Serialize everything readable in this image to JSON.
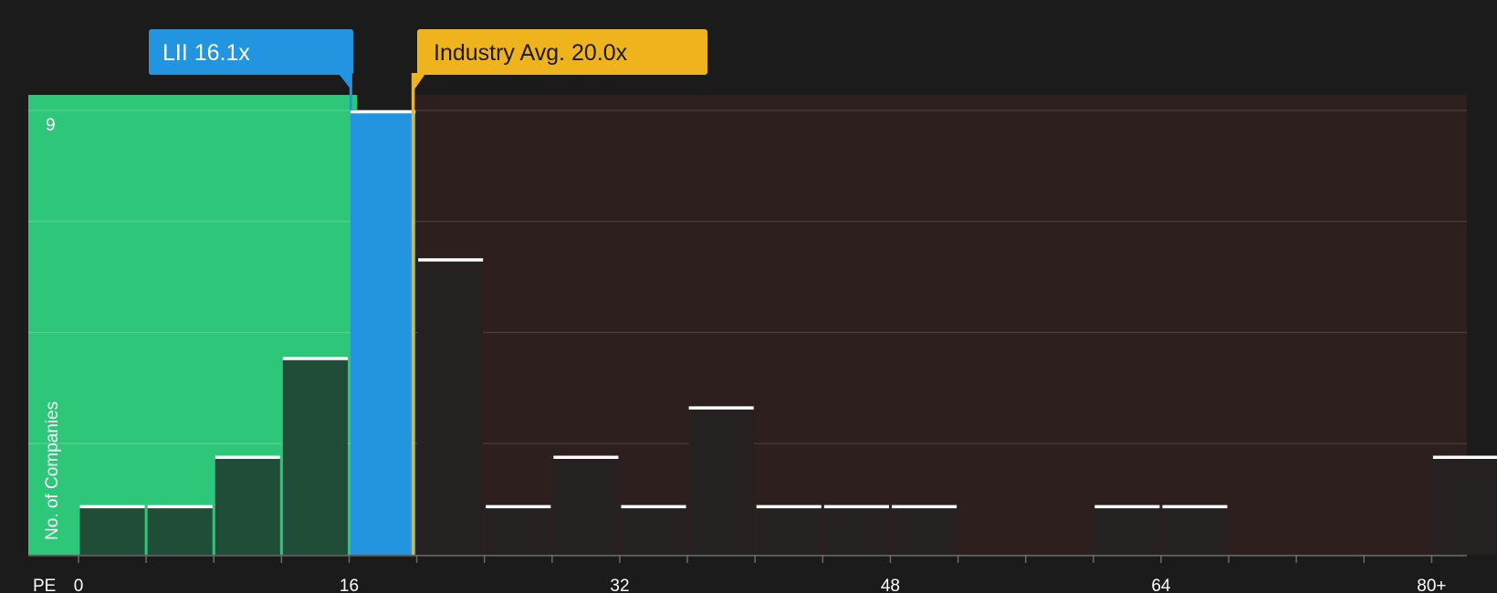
{
  "chart_data": {
    "type": "bar",
    "x_axis_label": "PE",
    "y_axis_label": "No. of Companies",
    "x_ticks": [
      "0",
      "16",
      "32",
      "48",
      "64",
      "80+"
    ],
    "x_tick_values": [
      0,
      16,
      32,
      48,
      64,
      80
    ],
    "y_max_label": "9",
    "ylim": [
      0,
      9
    ],
    "bin_width": 4,
    "bins": [
      {
        "x": 0,
        "value": 1
      },
      {
        "x": 4,
        "value": 1
      },
      {
        "x": 8,
        "value": 2
      },
      {
        "x": 12,
        "value": 4
      },
      {
        "x": 16,
        "value": 9
      },
      {
        "x": 20,
        "value": 6
      },
      {
        "x": 24,
        "value": 1
      },
      {
        "x": 28,
        "value": 2
      },
      {
        "x": 32,
        "value": 1
      },
      {
        "x": 36,
        "value": 3
      },
      {
        "x": 40,
        "value": 1
      },
      {
        "x": 44,
        "value": 1
      },
      {
        "x": 48,
        "value": 1
      },
      {
        "x": 60,
        "value": 1
      },
      {
        "x": 64,
        "value": 1
      },
      {
        "x": 80,
        "value": 2
      }
    ],
    "company": {
      "label": "LII 16.1x",
      "value": 16.1,
      "color": "#2394e0"
    },
    "industry_avg": {
      "label": "Industry Avg. 20.0x",
      "value": 20.0,
      "color": "#efb31d"
    },
    "grid": true,
    "colors": {
      "background": "#1b1b1b",
      "below_region": "#2ec77a",
      "above_region": "#2e1f1f",
      "bar_below": "#1f4d37",
      "bar_above": "#252121",
      "bar_company": "#2394e0",
      "cap": "#ffffff",
      "grid": "#4a3c3c"
    }
  }
}
